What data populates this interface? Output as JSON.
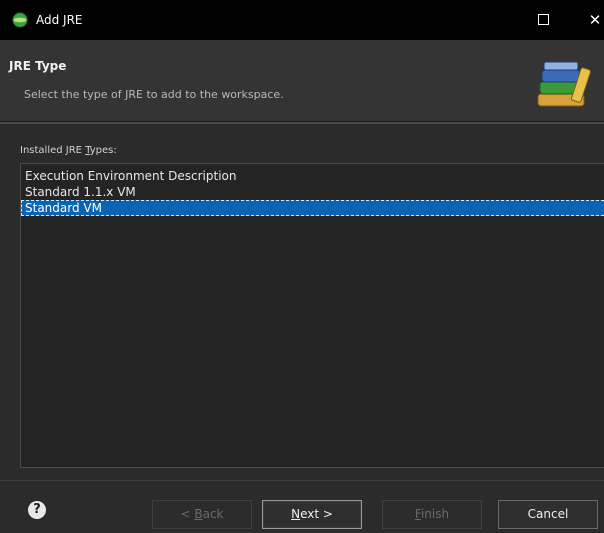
{
  "window": {
    "title": "Add JRE",
    "maximize_label": "",
    "close_label": "✕"
  },
  "header": {
    "title": "JRE Type",
    "description": "Select the type of JRE to add to the workspace."
  },
  "types": {
    "label_prefix": "Installed JRE ",
    "label_mnemonic": "T",
    "label_suffix": "ypes:",
    "items": [
      "Execution Environment Description",
      "Standard 1.1.x VM",
      "Standard VM"
    ],
    "selected_index": 2
  },
  "buttons": {
    "help": "?",
    "back_prefix": "< ",
    "back_mnemonic": "B",
    "back_suffix": "ack",
    "next_mnemonic": "N",
    "next_suffix": "ext >",
    "finish_mnemonic": "F",
    "finish_suffix": "inish",
    "cancel": "Cancel"
  },
  "colors": {
    "selection": "#0a64b4",
    "background": "#2b2b2b",
    "titlebar": "#000000"
  },
  "icons": {
    "app": "eclipse-icon",
    "wizard": "jre-books-icon",
    "help": "help-icon"
  }
}
